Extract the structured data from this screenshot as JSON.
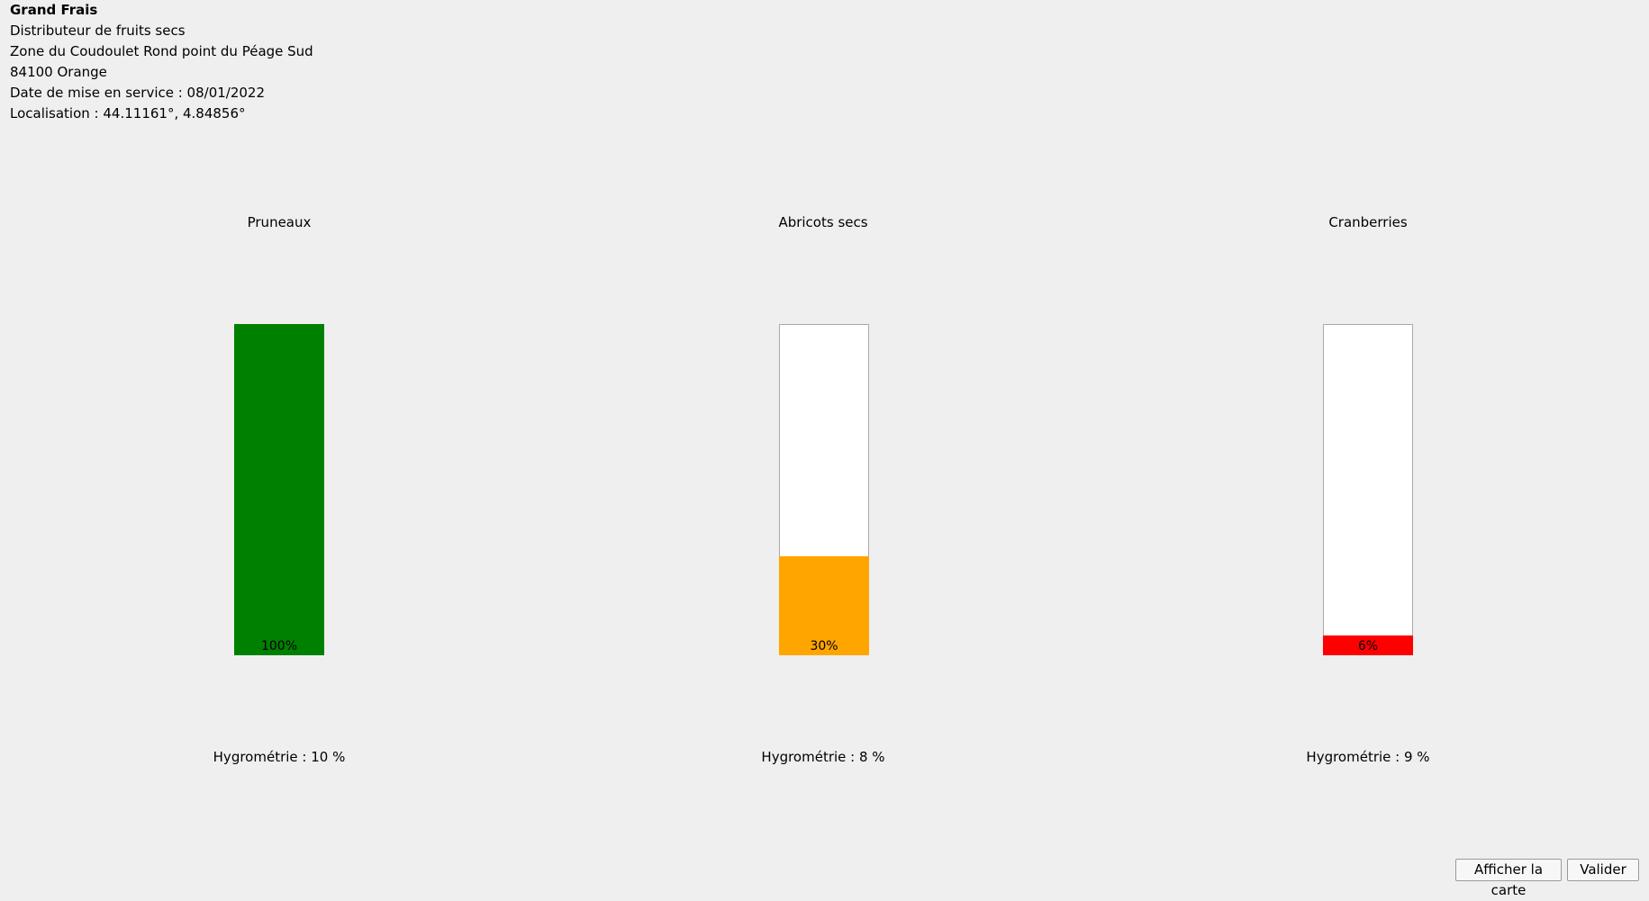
{
  "store": {
    "name": "Grand Frais",
    "type": "Distributeur de fruits secs",
    "address_line": "Zone du Coudoulet Rond point du Péage Sud",
    "city_line": "84100 Orange",
    "service_date_line": "Date de mise en service : 08/01/2022",
    "location_line": "Localisation : 44.11161°, 4.84856°"
  },
  "products": [
    {
      "name": "Pruneaux",
      "level_percent": 100,
      "level_label": "100%",
      "fill_color": "#008000",
      "hygrometry_label": "Hygrométrie : 10 %"
    },
    {
      "name": "Abricots secs",
      "level_percent": 30,
      "level_label": "30%",
      "fill_color": "#ffa500",
      "hygrometry_label": "Hygrométrie : 8 %"
    },
    {
      "name": "Cranberries",
      "level_percent": 6,
      "level_label": "6%",
      "fill_color": "#ff0000",
      "hygrometry_label": "Hygrométrie : 9 %"
    }
  ],
  "actions": {
    "show_map_label": "Afficher la carte",
    "validate_label": "Valider"
  }
}
